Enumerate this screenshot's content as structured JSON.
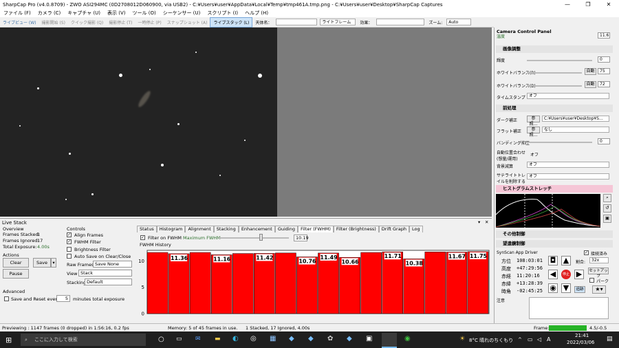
{
  "window": {
    "title": "SharpCap Pro (v4.0.8709) - ZWO ASI294MC (0D2708012D060900, via USB2) - C:¥Users¥user¥AppData¥Local¥Temp¥tmp461A.tmp.png - C:¥Users¥user¥Desktop¥SharpCap Captures"
  },
  "menu": [
    "ファイル (F)",
    "カメラ (C)",
    "キャプチャ (U)",
    "表示 (V)",
    "ツール (O)",
    "シーケンサー (U)",
    "スクリプト (I)",
    "ヘルプ (H)"
  ],
  "toolbar": {
    "items": [
      "ライブビュー (W)",
      "撮影開始 (S)",
      "クイック撮影 (Q)",
      "撮影停止 (T)",
      "一時停止 (P)",
      "スナップショット (A)",
      "ライブスタック (L)"
    ],
    "target_label": "天体名：",
    "frame_select": "ライトフレーム",
    "effect_label": "効果：",
    "zoom_label": "ズーム:",
    "zoom_value": "Auto"
  },
  "live_stack": {
    "title": "Live Stack",
    "overview": "Overview",
    "frames_stacked_label": "Frames Stacked:",
    "frames_stacked": "1",
    "frames_ignored_label": "Frames Ignored:",
    "frames_ignored": "17",
    "total_exposure_label": "Total Exposure:",
    "total_exposure": "4.00s",
    "actions": "Actions",
    "clear": "Clear",
    "save": "Save",
    "pause": "Pause",
    "advanced": "Advanced",
    "save_reset_label": "Save and Reset every",
    "save_reset_value": "5",
    "save_reset_suffix": "minutes total exposure",
    "controls": "Controls",
    "align_frames": "Align Frames",
    "fwhm_filter": "FWHM Filter",
    "brightness_filter": "Brightness Filter",
    "autosave": "Auto Save on Clear/Close",
    "raw_frames_label": "Raw Frames",
    "raw_frames_value": "Save None",
    "view_label": "View",
    "view_value": "Stack",
    "stacking_label": "Stacking",
    "stacking_value": "Default"
  },
  "tabs": [
    "Status",
    "Histogram",
    "Alignment",
    "Stacking",
    "Enhancement",
    "Guiding",
    "Filter (FWHM)",
    "Filter (Brightness)",
    "Drift Graph",
    "Log"
  ],
  "fwhm": {
    "filter_label": "Filter on FWHM",
    "max_label": "Maximum FWHM",
    "max_value": "10.19",
    "history_label": "FWHM History"
  },
  "chart_data": {
    "type": "bar",
    "title": "FWHM History",
    "xlabel": "",
    "ylabel": "",
    "ylim": [
      0,
      12
    ],
    "yticks": [
      0,
      5,
      10
    ],
    "threshold": 10.19,
    "bar_color": "#ff0000",
    "values": [
      11.6,
      11.36,
      11.6,
      11.16,
      11.4,
      11.42,
      11.5,
      10.76,
      11.49,
      10.66,
      11.6,
      11.71,
      10.38,
      11.7,
      11.67,
      11.75
    ],
    "labels": [
      "",
      "11.36",
      "",
      "11.16",
      "",
      "11.42",
      "",
      "10.76",
      "11.49",
      "10.66",
      "",
      "11.71",
      "10.38",
      "",
      "11.67",
      "11.75"
    ]
  },
  "status": {
    "preview": "Previewing : 1147 frames (0 dropped) in 1:56:16, 0.2 fps",
    "memory": "Memory: 5 of 45 frames in use.",
    "stacked": "1 Stacked, 17 Ignored, 4.00s",
    "frame_label": "Frame:",
    "frame_value": "4.5/-0.5"
  },
  "panel": {
    "gain_label": "温度",
    "gain_value": "11.6",
    "camera_control": "Camera Control Panel",
    "image_adjust": "画像調整",
    "brightness": "輝度",
    "brightness_value": "0",
    "wb_r": "ホワイトバランス(R)",
    "wb_r_value": "75",
    "wb_b": "ホワイトバランス(B)",
    "wb_b_value": "72",
    "auto": "自動",
    "timestamp": "タイムスタンプ",
    "timestamp_value": "オフ",
    "preprocess": "前処理",
    "dark": "ダーク補正",
    "dark_value": "C:¥Users¥user¥Desktop¥S…",
    "browse": "参照...",
    "flat": "フラット補正",
    "flat_value": "なし",
    "banding": "バンディング抑圧",
    "banding_value": "0",
    "autoalign": "自動位置合わせ(想量/運用)",
    "autoalign_value": "オフ",
    "bg_sub": "背景減算",
    "bg_sub_value": "オフ",
    "satellite": "サテライトトレイルを削除する",
    "satellite_value": "オフ",
    "histogram": "ヒストグラムストレッチ",
    "other": "その他制御",
    "telescope": "望遠鏡制御",
    "driver": "SynScan App Driver",
    "connected": "接続済み",
    "ra_label": "方位",
    "ra_value": "108:03:01",
    "alt_label": "高度",
    "alt_value": "+47:29:56",
    "ra2_label": "赤経",
    "ra2_value": "11:20:16",
    "dec_label": "赤緯",
    "dec_value": "+13:28:39",
    "ha_label": "時角",
    "ha_value": "-02:45:25",
    "rate_label": "割合:",
    "rate_value": "32x",
    "setup": "セットアップ",
    "park": "パーク",
    "stop": "停止",
    "track": "追跡",
    "notes": "注意"
  },
  "taskbar": {
    "search": "ここに入力して検索",
    "weather": "8°C 晴れのちくもり",
    "time": "21:41",
    "date": "2022/03/06",
    "lang": "A"
  }
}
